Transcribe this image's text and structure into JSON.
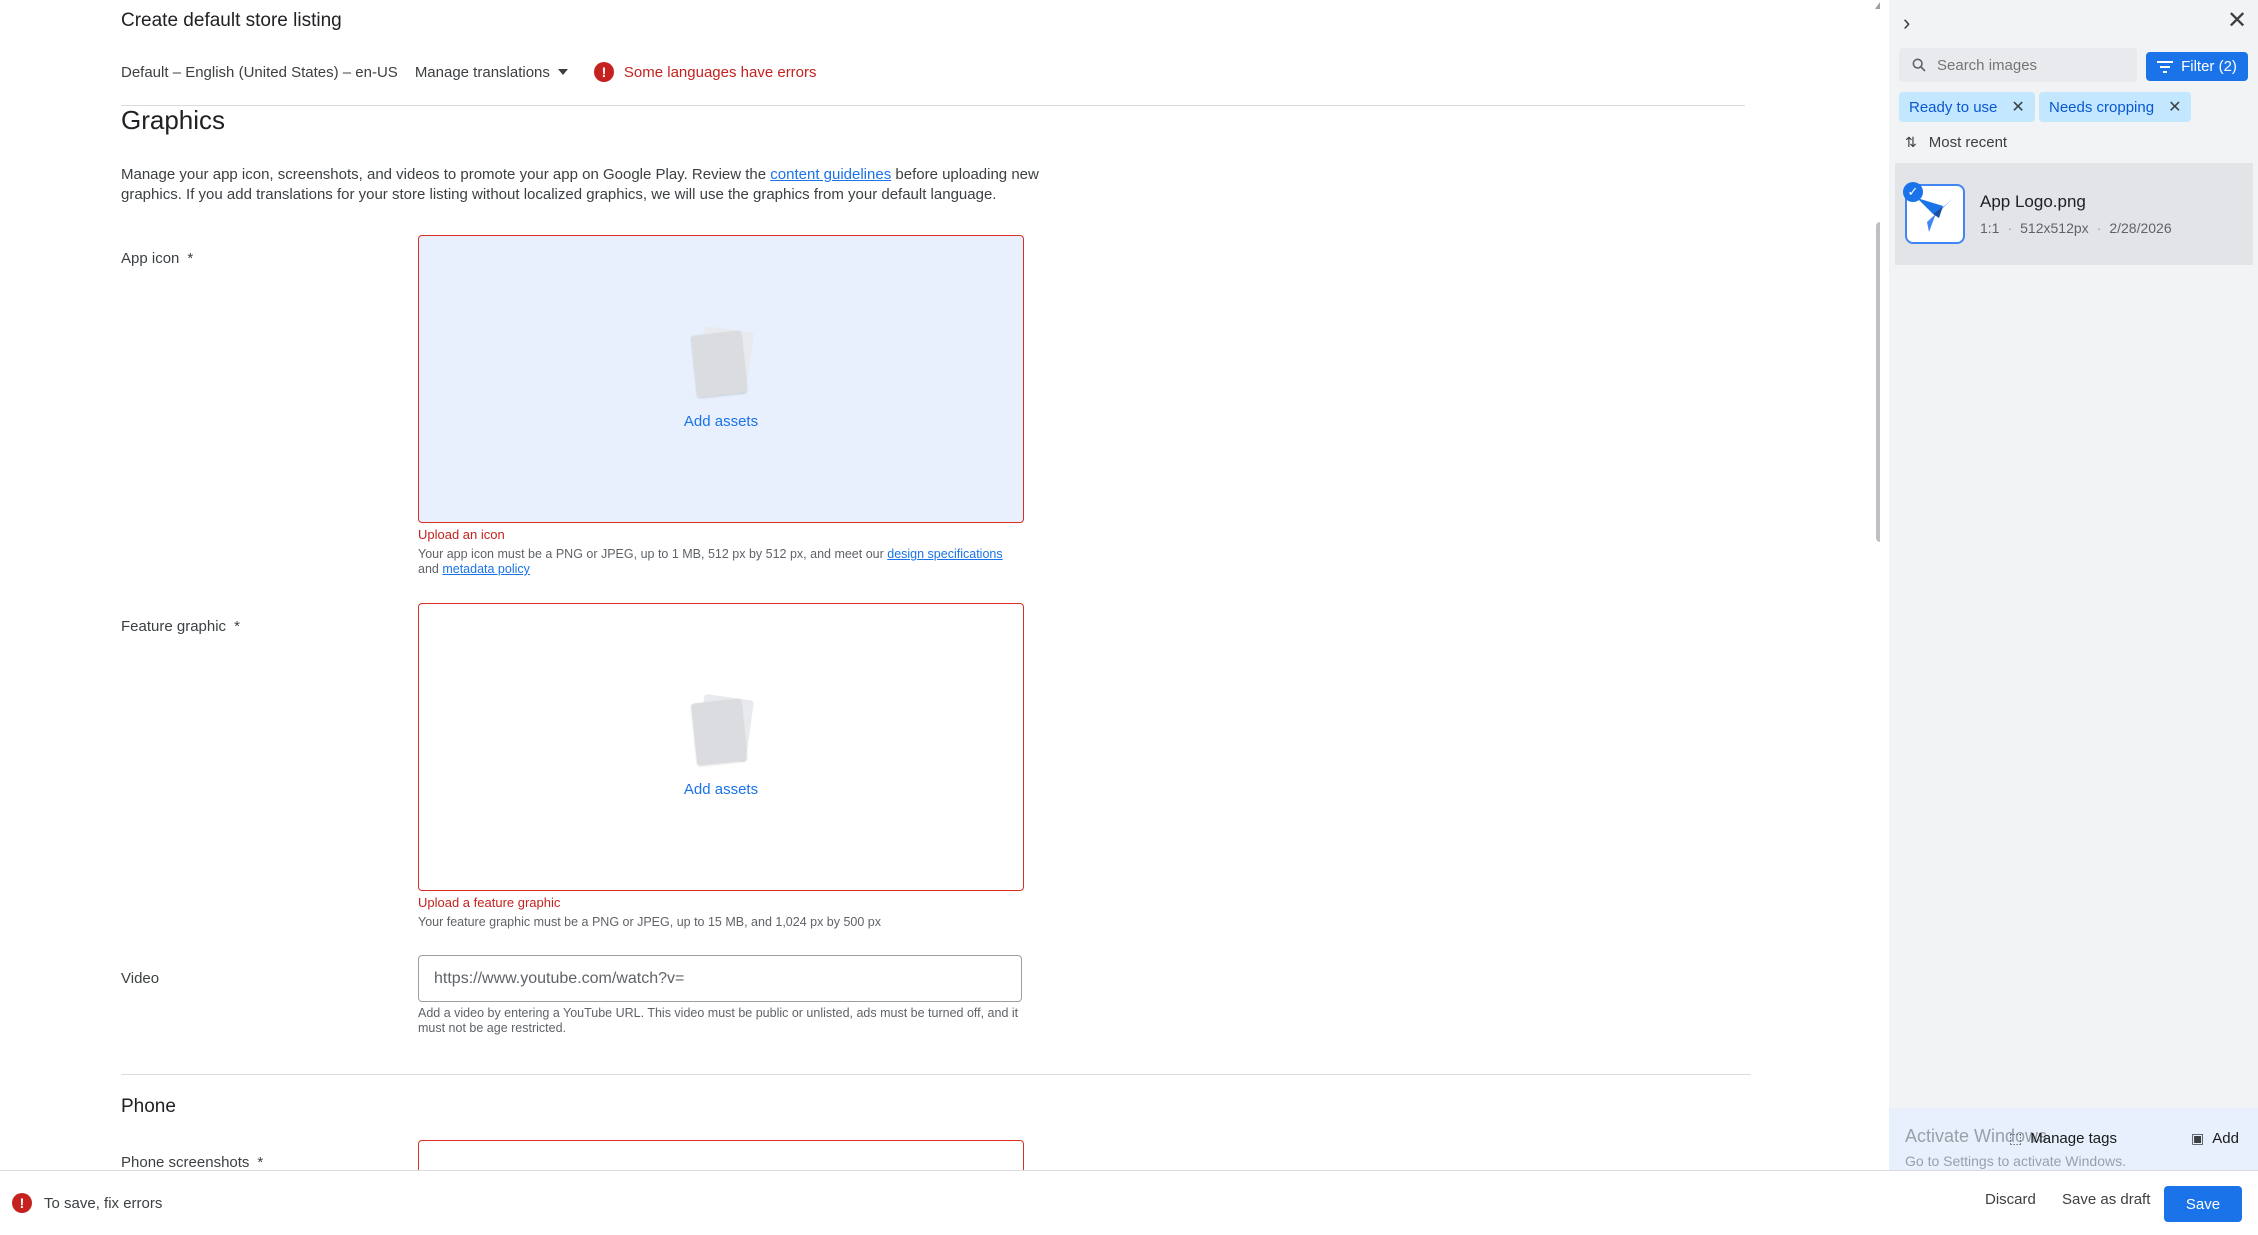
{
  "header": {
    "title": "Create default store listing",
    "language": "Default – English (United States) – en-US",
    "manage_translations": "Manage translations",
    "errors_text": "Some languages have errors"
  },
  "graphics": {
    "title": "Graphics",
    "desc_pre": "Manage your app icon, screenshots, and videos to promote your app on Google Play. Review the ",
    "desc_link": "content guidelines",
    "desc_post": " before uploading new graphics. If you add translations for your store listing without localized graphics, we will use the graphics from your default language.",
    "app_icon": {
      "label": "App icon",
      "required": "*",
      "add_assets": "Add assets",
      "error": "Upload an icon",
      "help_pre": "Your app icon must be a PNG or JPEG, up to 1 MB, 512 px by 512 px, and meet our ",
      "help_link1": "design specifications",
      "help_mid": " and ",
      "help_link2": "metadata policy"
    },
    "feature_graphic": {
      "label": "Feature graphic",
      "required": "*",
      "add_assets": "Add assets",
      "error": "Upload a feature graphic",
      "help": "Your feature graphic must be a PNG or JPEG, up to 15 MB, and 1,024 px by 500 px"
    },
    "video": {
      "label": "Video",
      "value": "https://www.youtube.com/watch?v=",
      "help": "Add a video by entering a YouTube URL. This video must be public or unlisted, ads must be turned off, and it must not be age restricted."
    }
  },
  "phone": {
    "title": "Phone",
    "screenshots_label": "Phone screenshots",
    "required": "*"
  },
  "panel": {
    "search_placeholder": "Search images",
    "filter_label": "Filter (2)",
    "chips": [
      "Ready to use",
      "Needs cropping"
    ],
    "sort_label": "Most recent",
    "item": {
      "name": "App Logo.png",
      "ratio": "1:1",
      "size": "512x512px",
      "date": "2/28/2026"
    },
    "watermark_line1": "Activate Windows",
    "watermark_line2": "Go to Settings to activate Windows.",
    "manage_tags": "Manage tags",
    "add": "Add"
  },
  "footer": {
    "error": "To save, fix errors",
    "discard": "Discard",
    "save_draft": "Save as draft",
    "save": "Save"
  },
  "colors": {
    "accent": "#1a73e8",
    "error": "#d93025",
    "dropzone_highlight": "#e8f0fe"
  }
}
